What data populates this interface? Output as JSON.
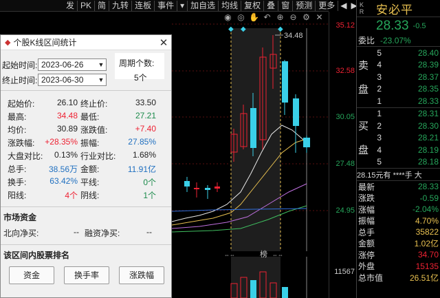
{
  "toolbar": {
    "items": [
      "发",
      "PK",
      "简",
      "九转",
      "连板",
      "事件",
      "▾",
      "加自选",
      "均线",
      "复权",
      "叠",
      "窗",
      "预测",
      "更多"
    ],
    "arrows": [
      "◀",
      "▶"
    ]
  },
  "chart": {
    "price_ticks": [
      "35.12",
      "32.58",
      "30.05",
      "27.48",
      "24.95"
    ],
    "high_marker": "34.48",
    "volume_tick": "11567",
    "bottom_label": "榜"
  },
  "quote": {
    "code_lines": [
      "K",
      "R"
    ],
    "name": "安必平",
    "price": "28.33",
    "change": "-0.5",
    "ratio_label": "委比",
    "ratio_value": "-23.07%",
    "sell_label": "卖盘",
    "buy_label": "买盘",
    "sell_levels": [
      {
        "lvl": "5",
        "px": "28.40"
      },
      {
        "lvl": "4",
        "px": "28.39"
      },
      {
        "lvl": "3",
        "px": "28.37"
      },
      {
        "lvl": "2",
        "px": "28.35"
      },
      {
        "lvl": "1",
        "px": "28.33"
      }
    ],
    "buy_levels": [
      {
        "lvl": "1",
        "px": "28.31"
      },
      {
        "lvl": "2",
        "px": "28.30"
      },
      {
        "lvl": "3",
        "px": "28.21"
      },
      {
        "lvl": "4",
        "px": "28.19"
      },
      {
        "lvl": "5",
        "px": "28.18"
      }
    ],
    "tail_line": "28.15元有 ****手 大",
    "stats": [
      {
        "label": "最新",
        "value": "28.33",
        "color": "grn"
      },
      {
        "label": "涨跌",
        "value": "-0.59",
        "color": "grn"
      },
      {
        "label": "涨幅",
        "value": "-2.04%",
        "color": "grn"
      },
      {
        "label": "振幅",
        "value": "4.70%",
        "color": "yel"
      },
      {
        "label": "总手",
        "value": "35822",
        "color": "yel"
      },
      {
        "label": "金额",
        "value": "1.02亿",
        "color": "yel"
      },
      {
        "label": "涨停",
        "value": "34.70",
        "color": "red"
      },
      {
        "label": "外盘",
        "value": "15135",
        "color": "red"
      },
      {
        "label": "总市值",
        "value": "26.51亿",
        "color": "yel"
      }
    ]
  },
  "dialog": {
    "title": "个股K线区间统计",
    "start_label": "起始时间:",
    "start_value": "2023-06-26",
    "end_label": "终止时间:",
    "end_value": "2023-06-30",
    "period_label": "周期个数:",
    "period_value": "5个",
    "rows": [
      {
        "l1": "起始价:",
        "v1": "26.10",
        "c1": "k",
        "l2": "终止价:",
        "v2": "33.50",
        "c2": "k"
      },
      {
        "l1": "最高:",
        "v1": "34.48",
        "c1": "r",
        "l2": "最低:",
        "v2": "27.21",
        "c2": "g"
      },
      {
        "l1": "均价:",
        "v1": "30.89",
        "c1": "k",
        "l2": "涨跌值:",
        "v2": "+7.40",
        "c2": "r"
      },
      {
        "l1": "涨跌幅:",
        "v1": "+28.35%",
        "c1": "r",
        "l2": "振幅:",
        "v2": "27.85%",
        "c2": "b"
      },
      {
        "l1": "大盘对比:",
        "v1": "0.13%",
        "c1": "k",
        "l2": "行业对比:",
        "v2": "1.68%",
        "c2": "k"
      },
      {
        "l1": "总手:",
        "v1": "38.56万",
        "c1": "b",
        "l2": "金额:",
        "v2": "11.91亿",
        "c2": "b"
      },
      {
        "l1": "换手:",
        "v1": "63.42%",
        "c1": "b",
        "l2": "平线:",
        "v2": "0个",
        "c2": "g"
      },
      {
        "l1": "阳线:",
        "v1": "4个",
        "c1": "r",
        "l2": "阴线:",
        "v2": "1个",
        "c2": "g"
      }
    ],
    "fund_section": "市场资金",
    "north_label": "北向净买:",
    "north_value": "--",
    "margin_label": "融资净买:",
    "margin_value": "--",
    "rank_section": "该区间内股票排名",
    "buttons": [
      "资金",
      "换手率",
      "涨跌幅"
    ]
  },
  "colors": {
    "up": "#e23",
    "down": "#26a65b",
    "candle_up": "#e23",
    "candle_down": "#3ad0e8",
    "ma5": "#e8e8e8",
    "ma10": "#e8c050",
    "ma20": "#c070e0",
    "ma30": "#40c060",
    "ma60": "#3070e0"
  }
}
